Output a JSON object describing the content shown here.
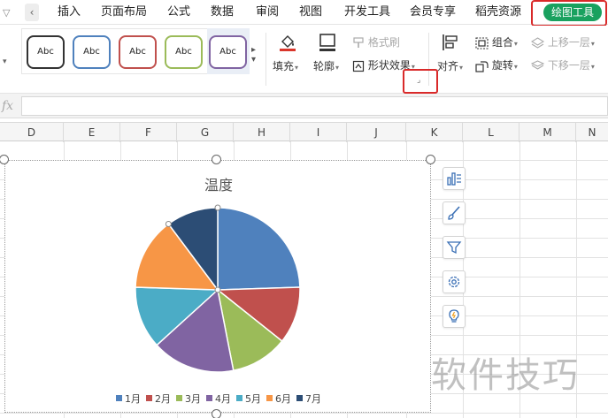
{
  "menu": {
    "tabs": [
      "插入",
      "页面布局",
      "公式",
      "数据",
      "审阅",
      "视图",
      "开发工具",
      "会员专享",
      "稻壳资源"
    ],
    "active_tab": "绘图工具"
  },
  "ribbon": {
    "styles": [
      "Abc",
      "Abc",
      "Abc",
      "Abc",
      "Abc"
    ],
    "style_colors": [
      "#1a1a1a",
      "#4f81bd",
      "#c0504d",
      "#9bbb59",
      "#8064a2"
    ],
    "fill_label": "填充",
    "outline_label": "轮廓",
    "format_painter_label": "格式刷",
    "shape_effects_label": "形状效果",
    "align_label": "对齐",
    "group_label": "组合",
    "rotate_label": "旋转",
    "bring_forward_label": "上移一层",
    "send_backward_label": "下移一层"
  },
  "formula_bar": {
    "fx": "fx",
    "value": ""
  },
  "columns": [
    "D",
    "E",
    "F",
    "G",
    "H",
    "I",
    "J",
    "K",
    "L",
    "M",
    "N"
  ],
  "chart_data": {
    "type": "pie",
    "title": "温度",
    "categories": [
      "1月",
      "2月",
      "3月",
      "4月",
      "5月",
      "6月",
      "7月"
    ],
    "values": [
      24,
      11,
      11,
      16,
      12,
      14,
      10
    ],
    "colors": [
      "#4f81bd",
      "#c0504d",
      "#9bbb59",
      "#8064a2",
      "#4bacc6",
      "#f79646",
      "#2c4d75"
    ],
    "legend_position": "bottom"
  },
  "chart_tools": [
    "chart-elements-icon",
    "chart-style-icon",
    "chart-filter-icon",
    "chart-settings-icon",
    "chart-insight-icon"
  ],
  "watermark": "软件技巧"
}
